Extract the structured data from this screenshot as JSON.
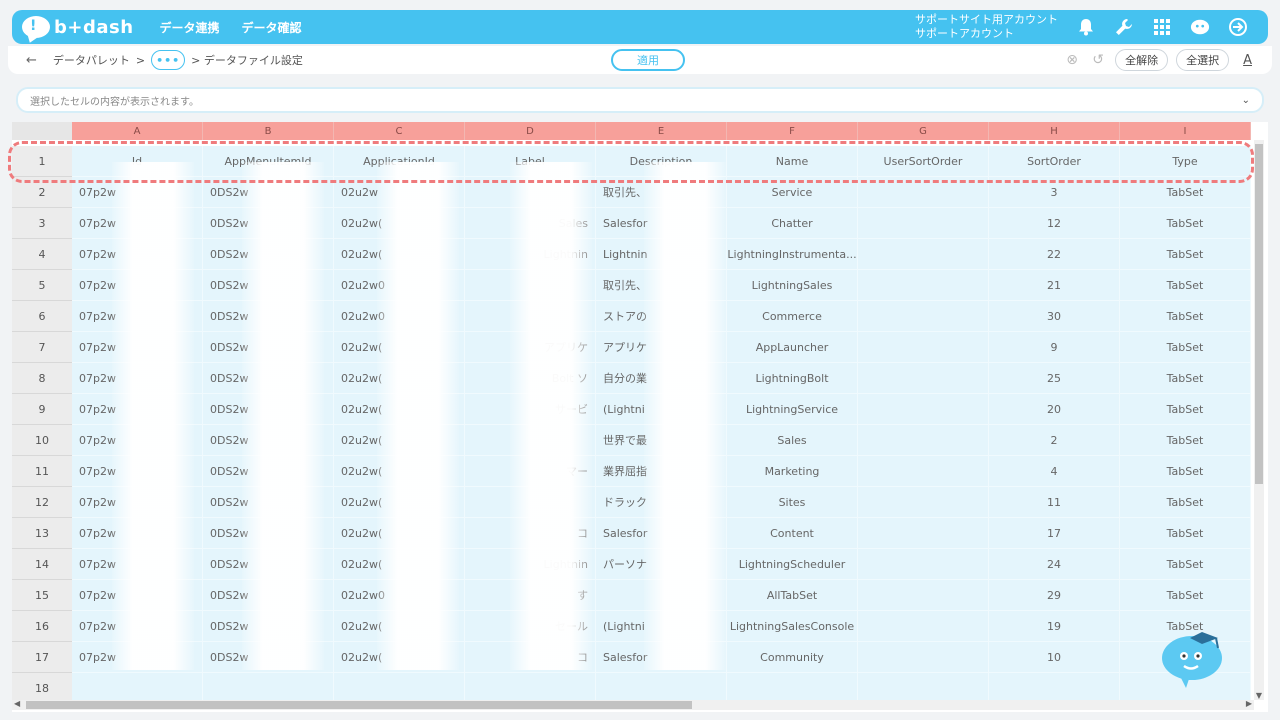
{
  "header": {
    "logo_text": "b+dash",
    "nav": [
      "データ連携",
      "データ確認"
    ],
    "account_line1": "サポートサイト用アカウント",
    "account_line2": "サポートアカウント",
    "icons": [
      "bell-icon",
      "wrench-icon",
      "grid-icon",
      "brain-icon",
      "logout-icon"
    ]
  },
  "toolbar": {
    "back": "←",
    "crumb1": "データパレット",
    "sep": ">",
    "dots": "•••",
    "crumb2": "> データファイル設定",
    "apply": "適用",
    "clear_all": "全解除",
    "select_all": "全選択",
    "font_icon": "A"
  },
  "cellbox": {
    "placeholder": "選択したセルの内容が表示されます。"
  },
  "grid": {
    "columns": [
      "A",
      "B",
      "C",
      "D",
      "E",
      "F",
      "G",
      "H",
      "I"
    ],
    "header_row_num": "1",
    "headers": [
      "Id",
      "AppMenuItemId",
      "ApplicationId",
      "Label",
      "Description",
      "Name",
      "UserSortOrder",
      "SortOrder",
      "Type"
    ],
    "rows": [
      {
        "n": "2",
        "a": "07p2w",
        "b": "0DS2w",
        "c": "02u2w",
        "d": "",
        "e": "取引先、",
        "f": "Service",
        "g": "",
        "h": "3",
        "i": "TabSet"
      },
      {
        "n": "3",
        "a": "07p2w",
        "b": "0DS2w",
        "c": "02u2w(",
        "d": "Sales",
        "e": "Salesfor",
        "f": "Chatter",
        "g": "",
        "h": "12",
        "i": "TabSet"
      },
      {
        "n": "4",
        "a": "07p2w",
        "b": "0DS2w",
        "c": "02u2w(",
        "d": "Lightnin",
        "e": "Lightnin",
        "f": "LightningInstrumenta...",
        "g": "",
        "h": "22",
        "i": "TabSet"
      },
      {
        "n": "5",
        "a": "07p2w",
        "b": "0DS2w",
        "c": "02u2w0",
        "d": "",
        "e": "取引先、",
        "f": "LightningSales",
        "g": "",
        "h": "21",
        "i": "TabSet"
      },
      {
        "n": "6",
        "a": "07p2w",
        "b": "0DS2w",
        "c": "02u2w0",
        "d": "",
        "e": "ストアの",
        "f": "Commerce",
        "g": "",
        "h": "30",
        "i": "TabSet"
      },
      {
        "n": "7",
        "a": "07p2w",
        "b": "0DS2w",
        "c": "02u2w(",
        "d": "アプリケ",
        "e": "アプリケ",
        "f": "AppLauncher",
        "g": "",
        "h": "9",
        "i": "TabSet"
      },
      {
        "n": "8",
        "a": "07p2w",
        "b": "0DS2w",
        "c": "02u2w(",
        "d": "Bolt ソ",
        "e": "自分の業",
        "f": "LightningBolt",
        "g": "",
        "h": "25",
        "i": "TabSet"
      },
      {
        "n": "9",
        "a": "07p2w",
        "b": "0DS2w",
        "c": "02u2w(",
        "d": "サービ",
        "e": "(Lightni",
        "f": "LightningService",
        "g": "",
        "h": "20",
        "i": "TabSet"
      },
      {
        "n": "10",
        "a": "07p2w",
        "b": "0DS2w",
        "c": "02u2w(",
        "d": "",
        "e": "世界で最",
        "f": "Sales",
        "g": "",
        "h": "2",
        "i": "TabSet"
      },
      {
        "n": "11",
        "a": "07p2w",
        "b": "0DS2w",
        "c": "02u2w(",
        "d": "マー",
        "e": "業界屈指",
        "f": "Marketing",
        "g": "",
        "h": "4",
        "i": "TabSet"
      },
      {
        "n": "12",
        "a": "07p2w",
        "b": "0DS2w",
        "c": "02u2w(",
        "d": "",
        "e": "ドラック",
        "f": "Sites",
        "g": "",
        "h": "11",
        "i": "TabSet"
      },
      {
        "n": "13",
        "a": "07p2w",
        "b": "0DS2w",
        "c": "02u2w(",
        "d": "コ",
        "e": "Salesfor",
        "f": "Content",
        "g": "",
        "h": "17",
        "i": "TabSet"
      },
      {
        "n": "14",
        "a": "07p2w",
        "b": "0DS2w",
        "c": "02u2w(",
        "d": "Lightnin",
        "e": "パーソナ",
        "f": "LightningScheduler",
        "g": "",
        "h": "24",
        "i": "TabSet"
      },
      {
        "n": "15",
        "a": "07p2w",
        "b": "0DS2w",
        "c": "02u2w0",
        "d": "す",
        "e": "",
        "f": "AllTabSet",
        "g": "",
        "h": "29",
        "i": "TabSet"
      },
      {
        "n": "16",
        "a": "07p2w",
        "b": "0DS2w",
        "c": "02u2w(",
        "d": "セール",
        "e": "(Lightni",
        "f": "LightningSalesConsole",
        "g": "",
        "h": "19",
        "i": "TabSet"
      },
      {
        "n": "17",
        "a": "07p2w",
        "b": "0DS2w",
        "c": "02u2w(",
        "d": "コ",
        "e": "Salesfor",
        "f": "Community",
        "g": "",
        "h": "10",
        "i": "TabSet"
      },
      {
        "n": "18",
        "a": "",
        "b": "",
        "c": "",
        "d": "",
        "e": "",
        "f": "",
        "g": "",
        "h": "",
        "i": ""
      }
    ]
  },
  "colors": {
    "accent": "#45c2f0",
    "column_header": "#f7a09a",
    "cell_bg": "#e4f5fc",
    "highlight": "#ef7b7d"
  }
}
